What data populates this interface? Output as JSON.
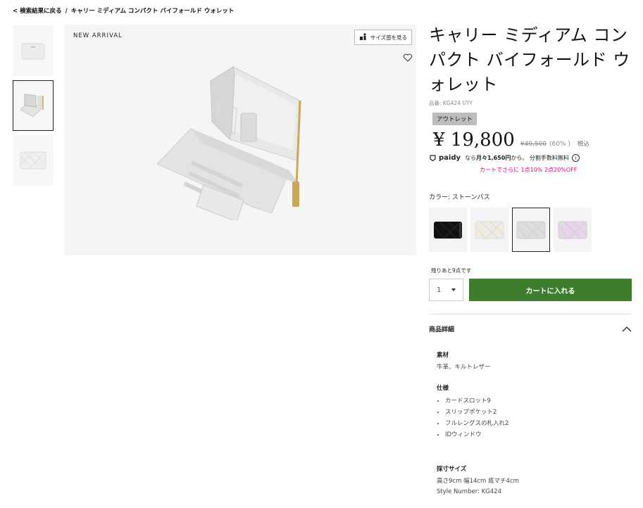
{
  "breadcrumb": {
    "back": "< 検索結果に戻る",
    "separator": "/",
    "current": "キャリー ミディアム コンパクト バイフォールド ウォレット"
  },
  "image": {
    "badge": "NEW ARRIVAL",
    "size_button": "サイズ感を見る"
  },
  "product": {
    "title": "キャリー ミディアム コンパクト バイフォールド ウォレット",
    "sku": "品番: KG424 UYY",
    "outlet_badge": "アウトレット",
    "price": "¥ 19,800",
    "original_price": "¥49,500",
    "discount": "(60% )",
    "tax": "税込"
  },
  "paidy": {
    "logo": "paidy",
    "text_pre": "なら",
    "text_strong": "月々1,650円",
    "text_post": "から。 分割手数料無料"
  },
  "promo": "カートでさらに 1点10% 2点20%OFF",
  "color": {
    "label": "カラー: ストーンパス",
    "swatches": [
      {
        "name": "black",
        "hex": "#111111"
      },
      {
        "name": "cream",
        "hex": "#eeebe3"
      },
      {
        "name": "stone",
        "hex": "#dcdedb"
      },
      {
        "name": "lilac",
        "hex": "#e4d6e6"
      }
    ],
    "selected_index": 2
  },
  "stock": "残りあと9点です",
  "cart": {
    "qty": "1",
    "button": "カートに入れる"
  },
  "details": {
    "heading": "商品詳細",
    "material_heading": "素材",
    "material": "牛革、キルトレザー",
    "spec_heading": "仕様",
    "specs": [
      "カードスロット9",
      "スリップポケット2",
      "フルレングスの札入れ2",
      "IDウィンドウ"
    ],
    "size_heading": "採寸サイズ",
    "size": "高さ9cm 幅14cm 底マチ4cm",
    "style_number": "Style Number: KG424"
  },
  "colors": {
    "cart_green": "#3e7d2d",
    "promo_pink": "#e4007f"
  }
}
